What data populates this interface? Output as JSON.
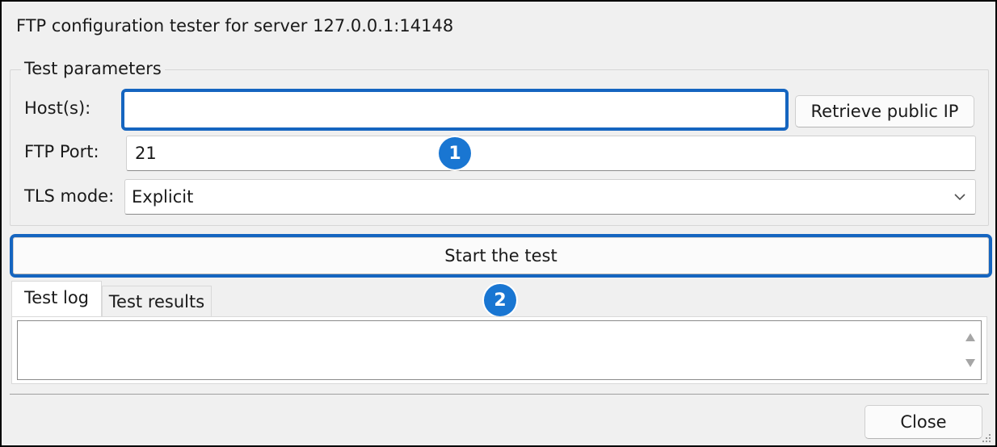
{
  "window": {
    "title": "FTP configuration tester for server 127.0.0.1:14148"
  },
  "test_parameters": {
    "legend": "Test parameters",
    "host": {
      "label": "Host(s):",
      "value": "",
      "placeholder": ""
    },
    "retrieve_ip_button": "Retrieve public IP",
    "port": {
      "label": "FTP Port:",
      "value": "21"
    },
    "tls": {
      "label": "TLS mode:",
      "selected": "Explicit"
    }
  },
  "start_button": "Start the test",
  "annotations": {
    "badge_1": "1",
    "badge_2": "2",
    "highlight_color": "#1565c0",
    "badge_color": "#1976d2"
  },
  "tabs": [
    {
      "label": "Test log",
      "active": true
    },
    {
      "label": "Test results",
      "active": false
    }
  ],
  "log": {
    "content": ""
  },
  "footer": {
    "close_button": "Close"
  },
  "icons": {
    "dropdown": "chevron-down-icon",
    "scroll_up": "scroll-up-arrow-icon",
    "scroll_down": "scroll-down-arrow-icon",
    "resize": "resize-grip-icon"
  }
}
